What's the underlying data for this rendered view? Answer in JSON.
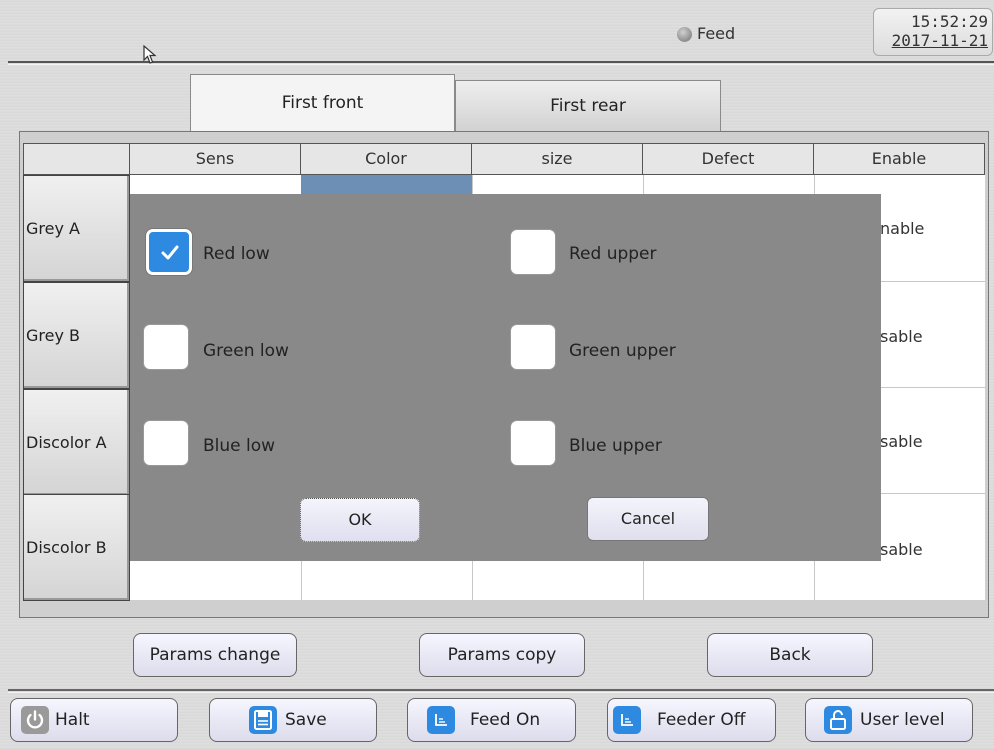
{
  "status": {
    "feed_label": "Feed",
    "time": "15:52:29",
    "date": "2017-11-21"
  },
  "tabs": [
    {
      "label": "First front",
      "active": true
    },
    {
      "label": "First rear",
      "active": false
    }
  ],
  "table": {
    "headers": [
      "",
      "Sens",
      "Color",
      "size",
      "Defect",
      "Enable"
    ],
    "rows": [
      {
        "label": "Grey A",
        "enable": "nable"
      },
      {
        "label": "Grey B",
        "enable": "sable"
      },
      {
        "label": "Discolor A",
        "enable": "sable"
      },
      {
        "label": "Discolor B",
        "enable": "sable"
      }
    ]
  },
  "dialog": {
    "options": [
      {
        "label": "Red low",
        "checked": true
      },
      {
        "label": "Red upper",
        "checked": false
      },
      {
        "label": "Green low",
        "checked": false
      },
      {
        "label": "Green upper",
        "checked": false
      },
      {
        "label": "Blue low",
        "checked": false
      },
      {
        "label": "Blue upper",
        "checked": false
      }
    ],
    "ok_label": "OK",
    "cancel_label": "Cancel"
  },
  "actions": {
    "params_change": "Params change",
    "params_copy": "Params copy",
    "back": "Back"
  },
  "footer": [
    {
      "label": "Halt",
      "icon": "power-icon",
      "color": "#9a9a9a"
    },
    {
      "label": "Save",
      "icon": "save-icon",
      "color": "#2d8ae0"
    },
    {
      "label": "Feed On",
      "icon": "feed-icon",
      "color": "#2d8ae0"
    },
    {
      "label": "Feeder Off",
      "icon": "feed-icon",
      "color": "#2d8ae0"
    },
    {
      "label": "User level",
      "icon": "unlock-icon",
      "color": "#2d8ae0"
    }
  ],
  "colors": {
    "accent": "#2d8ae0",
    "dialog_bg": "#898989",
    "selected_cell": "#6d8fb5"
  }
}
